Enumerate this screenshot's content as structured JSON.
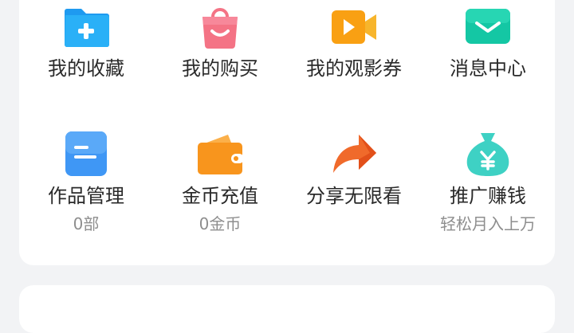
{
  "menu": {
    "row1": [
      {
        "label": "我的收藏",
        "icon": "folder-plus-icon"
      },
      {
        "label": "我的购买",
        "icon": "shopping-bag-icon"
      },
      {
        "label": "我的观影券",
        "icon": "video-camera-icon"
      },
      {
        "label": "消息中心",
        "icon": "mail-icon"
      }
    ],
    "row2": [
      {
        "label": "作品管理",
        "icon": "document-icon",
        "sub": "0部"
      },
      {
        "label": "金币充值",
        "icon": "wallet-icon",
        "sub": "0金币"
      },
      {
        "label": "分享无限看",
        "icon": "share-arrow-icon"
      },
      {
        "label": "推广赚钱",
        "icon": "money-bag-yen-icon",
        "sub": "轻松月入上万"
      }
    ]
  },
  "colors": {
    "folder": "#1e9af0",
    "bag": "#f47385",
    "video": "#f9a013",
    "mail": "#14c7a4",
    "document": "#3f97f5",
    "wallet": "#f8951d",
    "share": "#f06a2b",
    "money_bag": "#3ed1c4"
  }
}
